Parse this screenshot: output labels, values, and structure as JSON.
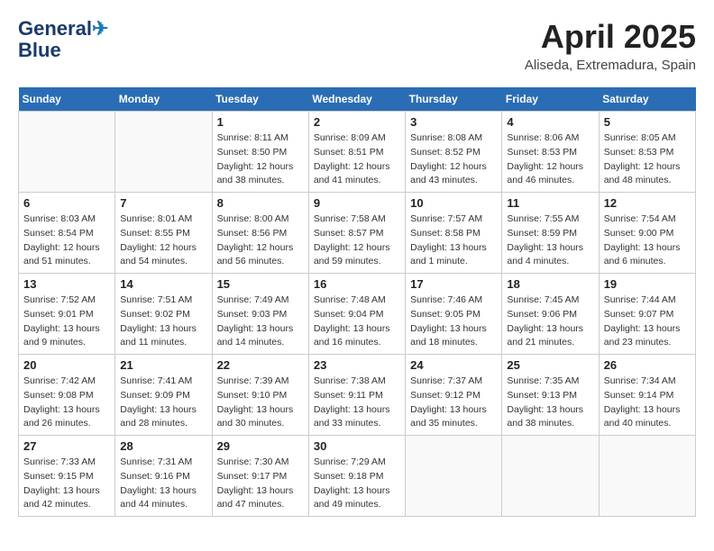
{
  "header": {
    "logo_line1": "General",
    "logo_line2": "Blue",
    "month": "April 2025",
    "location": "Aliseda, Extremadura, Spain"
  },
  "weekdays": [
    "Sunday",
    "Monday",
    "Tuesday",
    "Wednesday",
    "Thursday",
    "Friday",
    "Saturday"
  ],
  "weeks": [
    [
      {
        "day": "",
        "empty": true
      },
      {
        "day": "",
        "empty": true
      },
      {
        "day": "1",
        "sunrise": "Sunrise: 8:11 AM",
        "sunset": "Sunset: 8:50 PM",
        "daylight": "Daylight: 12 hours and 38 minutes."
      },
      {
        "day": "2",
        "sunrise": "Sunrise: 8:09 AM",
        "sunset": "Sunset: 8:51 PM",
        "daylight": "Daylight: 12 hours and 41 minutes."
      },
      {
        "day": "3",
        "sunrise": "Sunrise: 8:08 AM",
        "sunset": "Sunset: 8:52 PM",
        "daylight": "Daylight: 12 hours and 43 minutes."
      },
      {
        "day": "4",
        "sunrise": "Sunrise: 8:06 AM",
        "sunset": "Sunset: 8:53 PM",
        "daylight": "Daylight: 12 hours and 46 minutes."
      },
      {
        "day": "5",
        "sunrise": "Sunrise: 8:05 AM",
        "sunset": "Sunset: 8:53 PM",
        "daylight": "Daylight: 12 hours and 48 minutes."
      }
    ],
    [
      {
        "day": "6",
        "sunrise": "Sunrise: 8:03 AM",
        "sunset": "Sunset: 8:54 PM",
        "daylight": "Daylight: 12 hours and 51 minutes."
      },
      {
        "day": "7",
        "sunrise": "Sunrise: 8:01 AM",
        "sunset": "Sunset: 8:55 PM",
        "daylight": "Daylight: 12 hours and 54 minutes."
      },
      {
        "day": "8",
        "sunrise": "Sunrise: 8:00 AM",
        "sunset": "Sunset: 8:56 PM",
        "daylight": "Daylight: 12 hours and 56 minutes."
      },
      {
        "day": "9",
        "sunrise": "Sunrise: 7:58 AM",
        "sunset": "Sunset: 8:57 PM",
        "daylight": "Daylight: 12 hours and 59 minutes."
      },
      {
        "day": "10",
        "sunrise": "Sunrise: 7:57 AM",
        "sunset": "Sunset: 8:58 PM",
        "daylight": "Daylight: 13 hours and 1 minute."
      },
      {
        "day": "11",
        "sunrise": "Sunrise: 7:55 AM",
        "sunset": "Sunset: 8:59 PM",
        "daylight": "Daylight: 13 hours and 4 minutes."
      },
      {
        "day": "12",
        "sunrise": "Sunrise: 7:54 AM",
        "sunset": "Sunset: 9:00 PM",
        "daylight": "Daylight: 13 hours and 6 minutes."
      }
    ],
    [
      {
        "day": "13",
        "sunrise": "Sunrise: 7:52 AM",
        "sunset": "Sunset: 9:01 PM",
        "daylight": "Daylight: 13 hours and 9 minutes."
      },
      {
        "day": "14",
        "sunrise": "Sunrise: 7:51 AM",
        "sunset": "Sunset: 9:02 PM",
        "daylight": "Daylight: 13 hours and 11 minutes."
      },
      {
        "day": "15",
        "sunrise": "Sunrise: 7:49 AM",
        "sunset": "Sunset: 9:03 PM",
        "daylight": "Daylight: 13 hours and 14 minutes."
      },
      {
        "day": "16",
        "sunrise": "Sunrise: 7:48 AM",
        "sunset": "Sunset: 9:04 PM",
        "daylight": "Daylight: 13 hours and 16 minutes."
      },
      {
        "day": "17",
        "sunrise": "Sunrise: 7:46 AM",
        "sunset": "Sunset: 9:05 PM",
        "daylight": "Daylight: 13 hours and 18 minutes."
      },
      {
        "day": "18",
        "sunrise": "Sunrise: 7:45 AM",
        "sunset": "Sunset: 9:06 PM",
        "daylight": "Daylight: 13 hours and 21 minutes."
      },
      {
        "day": "19",
        "sunrise": "Sunrise: 7:44 AM",
        "sunset": "Sunset: 9:07 PM",
        "daylight": "Daylight: 13 hours and 23 minutes."
      }
    ],
    [
      {
        "day": "20",
        "sunrise": "Sunrise: 7:42 AM",
        "sunset": "Sunset: 9:08 PM",
        "daylight": "Daylight: 13 hours and 26 minutes."
      },
      {
        "day": "21",
        "sunrise": "Sunrise: 7:41 AM",
        "sunset": "Sunset: 9:09 PM",
        "daylight": "Daylight: 13 hours and 28 minutes."
      },
      {
        "day": "22",
        "sunrise": "Sunrise: 7:39 AM",
        "sunset": "Sunset: 9:10 PM",
        "daylight": "Daylight: 13 hours and 30 minutes."
      },
      {
        "day": "23",
        "sunrise": "Sunrise: 7:38 AM",
        "sunset": "Sunset: 9:11 PM",
        "daylight": "Daylight: 13 hours and 33 minutes."
      },
      {
        "day": "24",
        "sunrise": "Sunrise: 7:37 AM",
        "sunset": "Sunset: 9:12 PM",
        "daylight": "Daylight: 13 hours and 35 minutes."
      },
      {
        "day": "25",
        "sunrise": "Sunrise: 7:35 AM",
        "sunset": "Sunset: 9:13 PM",
        "daylight": "Daylight: 13 hours and 38 minutes."
      },
      {
        "day": "26",
        "sunrise": "Sunrise: 7:34 AM",
        "sunset": "Sunset: 9:14 PM",
        "daylight": "Daylight: 13 hours and 40 minutes."
      }
    ],
    [
      {
        "day": "27",
        "sunrise": "Sunrise: 7:33 AM",
        "sunset": "Sunset: 9:15 PM",
        "daylight": "Daylight: 13 hours and 42 minutes."
      },
      {
        "day": "28",
        "sunrise": "Sunrise: 7:31 AM",
        "sunset": "Sunset: 9:16 PM",
        "daylight": "Daylight: 13 hours and 44 minutes."
      },
      {
        "day": "29",
        "sunrise": "Sunrise: 7:30 AM",
        "sunset": "Sunset: 9:17 PM",
        "daylight": "Daylight: 13 hours and 47 minutes."
      },
      {
        "day": "30",
        "sunrise": "Sunrise: 7:29 AM",
        "sunset": "Sunset: 9:18 PM",
        "daylight": "Daylight: 13 hours and 49 minutes."
      },
      {
        "day": "",
        "empty": true
      },
      {
        "day": "",
        "empty": true
      },
      {
        "day": "",
        "empty": true
      }
    ]
  ]
}
